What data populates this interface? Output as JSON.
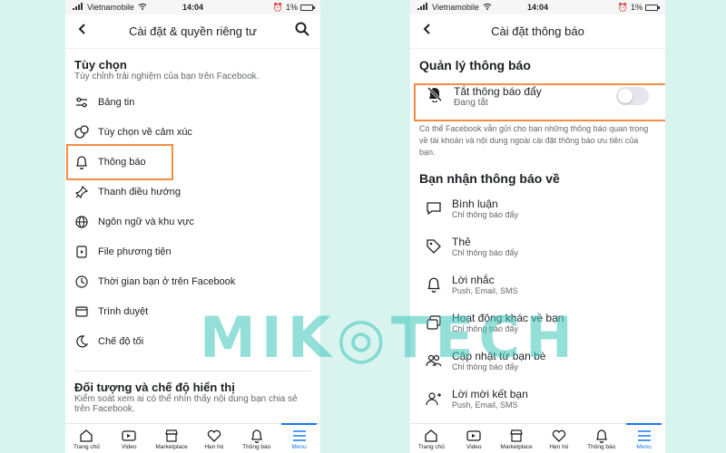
{
  "status_bar": {
    "carrier": "Vietnamobile",
    "time": "14:04",
    "battery": "1%"
  },
  "watermark": "MIK◎TECH",
  "left_screen": {
    "title": "Cài đặt & quyền riêng tư",
    "section1": {
      "title": "Tùy chọn",
      "subtitle": "Tùy chỉnh trải nghiệm của bạn trên Facebook."
    },
    "menu_items": [
      {
        "label": "Bảng tin",
        "icon": "sliders-icon"
      },
      {
        "label": "Tùy chọn về cảm xúc",
        "icon": "reactions-icon"
      },
      {
        "label": "Thông báo",
        "icon": "bell-icon"
      },
      {
        "label": "Thanh điều hướng",
        "icon": "pin-icon"
      },
      {
        "label": "Ngôn ngữ và khu vực",
        "icon": "globe-icon"
      },
      {
        "label": "File phương tiện",
        "icon": "media-icon"
      },
      {
        "label": "Thời gian bạn ở trên Facebook",
        "icon": "clock-icon"
      },
      {
        "label": "Trình duyệt",
        "icon": "browser-icon"
      },
      {
        "label": "Chế độ tối",
        "icon": "moon-icon"
      }
    ],
    "section2": {
      "title": "Đối tượng và chế độ hiển thị",
      "subtitle": "Kiểm soát xem ai có thể nhìn thấy nội dung bạn chia sẻ trên Facebook."
    }
  },
  "right_screen": {
    "title": "Cài đặt thông báo",
    "manage_title": "Quản lý thông báo",
    "push_toggle": {
      "label": "Tắt thông báo đẩy",
      "status": "Đang tắt",
      "enabled": false
    },
    "description": "Có thể Facebook vẫn gửi cho bạn những thông báo quan trọng về tài khoản và nội dung ngoài cài đặt thông báo ưu tiên của bạn.",
    "receive_title": "Bạn nhận thông báo về",
    "items": [
      {
        "label": "Bình luận",
        "sub": "Chỉ thông báo đẩy",
        "icon": "comment-icon"
      },
      {
        "label": "Thẻ",
        "sub": "Chỉ thông báo đẩy",
        "icon": "tag-icon"
      },
      {
        "label": "Lời nhắc",
        "sub": "Push, Email, SMS",
        "icon": "bell-icon"
      },
      {
        "label": "Hoạt động khác về bạn",
        "sub": "Chỉ thông báo đẩy",
        "icon": "activity-icon"
      },
      {
        "label": "Cập nhật từ bạn bè",
        "sub": "Chỉ thông báo đẩy",
        "icon": "friends-icon"
      },
      {
        "label": "Lời mời kết bạn",
        "sub": "Push, Email, SMS",
        "icon": "add-friend-icon"
      }
    ]
  },
  "bottom_nav": [
    {
      "label": "Trang chủ",
      "icon": "home-icon"
    },
    {
      "label": "Video",
      "icon": "video-icon"
    },
    {
      "label": "Marketplace",
      "icon": "marketplace-icon"
    },
    {
      "label": "Hẹn hò",
      "icon": "dating-icon"
    },
    {
      "label": "Thông báo",
      "icon": "bell-icon"
    },
    {
      "label": "Menu",
      "icon": "menu-icon",
      "active": true
    }
  ],
  "colors": {
    "accent": "#1877f2",
    "highlight": "#f28e43",
    "background": "#d9f3ef",
    "watermark": "#3ec7bb"
  }
}
